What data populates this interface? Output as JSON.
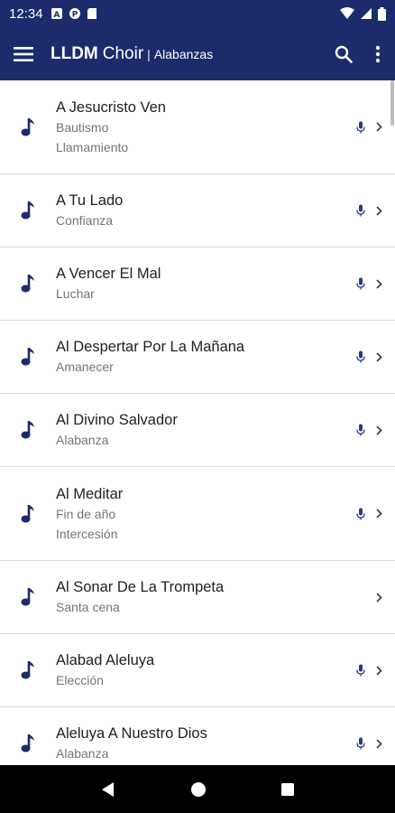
{
  "status": {
    "time": "12:34",
    "icons": [
      "notification-a-icon",
      "notification-p-icon",
      "sd-card-icon",
      "wifi-icon",
      "signal-icon",
      "battery-icon"
    ]
  },
  "app_bar": {
    "title_bold": "LLDM",
    "title_rest": "Choir",
    "separator": "|",
    "subtitle": "Alabanzas"
  },
  "songs": [
    {
      "title": "A Jesucristo Ven",
      "tags": [
        "Bautismo",
        "Llamamiento"
      ],
      "has_audio": true
    },
    {
      "title": "A Tu Lado",
      "tags": [
        "Confianza"
      ],
      "has_audio": true
    },
    {
      "title": "A Vencer El Mal",
      "tags": [
        "Luchar"
      ],
      "has_audio": true
    },
    {
      "title": "Al Despertar Por La Mañana",
      "tags": [
        "Amanecer"
      ],
      "has_audio": true
    },
    {
      "title": "Al Divino Salvador",
      "tags": [
        "Alabanza"
      ],
      "has_audio": true
    },
    {
      "title": "Al Meditar",
      "tags": [
        "Fin de año",
        "Intercesión"
      ],
      "has_audio": true
    },
    {
      "title": "Al Sonar De La Trompeta",
      "tags": [
        "Santa cena"
      ],
      "has_audio": false
    },
    {
      "title": "Alabad Aleluya",
      "tags": [
        "Elección"
      ],
      "has_audio": true
    },
    {
      "title": "Aleluya A Nuestro Dios",
      "tags": [
        "Alabanza"
      ],
      "has_audio": true
    }
  ],
  "colors": {
    "primary": "#1c2b6b",
    "note_icon": "#1c2b6b",
    "mic_icon": "#2d3a80",
    "title_text": "#212121",
    "sub_text": "#757575"
  }
}
